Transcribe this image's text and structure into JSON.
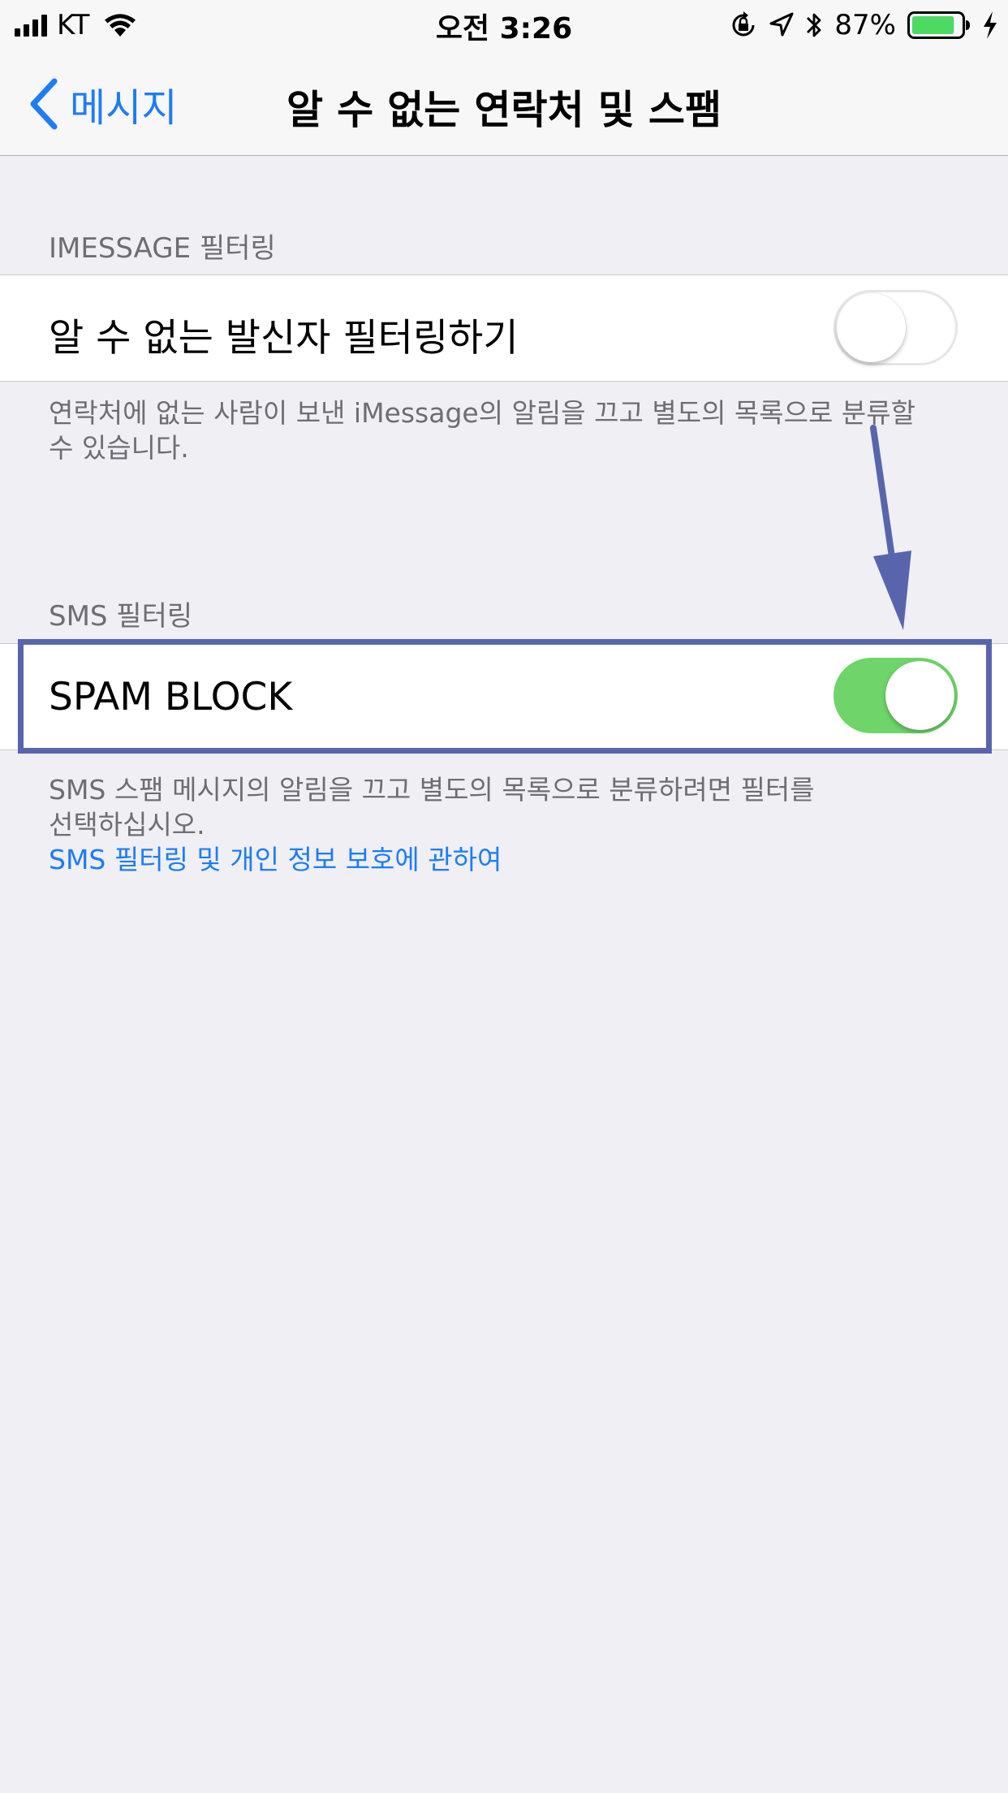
{
  "status_bar": {
    "carrier": "KT",
    "time": "오전 3:26",
    "battery_percent": "87%",
    "battery_level": 0.87,
    "icons": [
      "signal-icon",
      "wifi-icon",
      "orientation-lock-icon",
      "location-icon",
      "bluetooth-icon",
      "battery-icon",
      "charging-icon"
    ]
  },
  "nav": {
    "back_label": "메시지",
    "title": "알 수 없는 연락처 및 스팸"
  },
  "imessage_section": {
    "header": "IMESSAGE 필터링",
    "row_label": "알 수 없는 발신자 필터링하기",
    "toggle_on": false,
    "footer_line1": "연락처에 없는 사람이 보낸 iMessage의 알림을 끄고 별도의 목록으로 분류할",
    "footer_line2": "수 있습니다."
  },
  "sms_section": {
    "header": "SMS 필터링",
    "row_label": "SPAM BLOCK",
    "toggle_on": true,
    "footer_line1": "SMS 스팸 메시지의 알림을 끄고 별도의 목록으로 분류하려면 필터를",
    "footer_line2": "선택하십시오.",
    "footer_link": "SMS 필터링 및 개인 정보 보호에 관하여"
  },
  "colors": {
    "accent": "#1e7cf5",
    "toggle_on": "#6fd46a",
    "annotation": "#5865ad",
    "background": "#efeff4"
  }
}
